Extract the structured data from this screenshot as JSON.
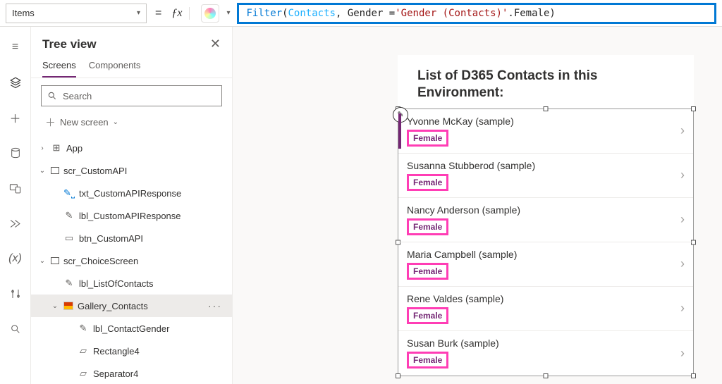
{
  "formula": {
    "property": "Items",
    "fn": "Filter",
    "arg1": "Contacts",
    "mid": ", Gender = ",
    "str": "'Gender (Contacts)'",
    "tail": ".Female)"
  },
  "tree": {
    "title": "Tree view",
    "tabs": {
      "screens": "Screens",
      "components": "Components"
    },
    "search_placeholder": "Search",
    "new_screen": "New screen",
    "nodes": {
      "app": "App",
      "scr_customapi": "scr_CustomAPI",
      "txt_customapiresponse": "txt_CustomAPIResponse",
      "lbl_customapiresponse": "lbl_CustomAPIResponse",
      "btn_customapi": "btn_CustomAPI",
      "scr_choice": "scr_ChoiceScreen",
      "lbl_listofcontacts": "lbl_ListOfContacts",
      "gallery_contacts": "Gallery_Contacts",
      "lbl_contactgender": "lbl_ContactGender",
      "rectangle4": "Rectangle4",
      "separator4": "Separator4"
    }
  },
  "form": {
    "title": "List of D365 Contacts in this Environment:",
    "rows": [
      {
        "name": "Yvonne McKay (sample)",
        "gender": "Female"
      },
      {
        "name": "Susanna Stubberod (sample)",
        "gender": "Female"
      },
      {
        "name": "Nancy Anderson (sample)",
        "gender": "Female"
      },
      {
        "name": "Maria Campbell (sample)",
        "gender": "Female"
      },
      {
        "name": "Rene Valdes (sample)",
        "gender": "Female"
      },
      {
        "name": "Susan Burk (sample)",
        "gender": "Female"
      }
    ]
  }
}
